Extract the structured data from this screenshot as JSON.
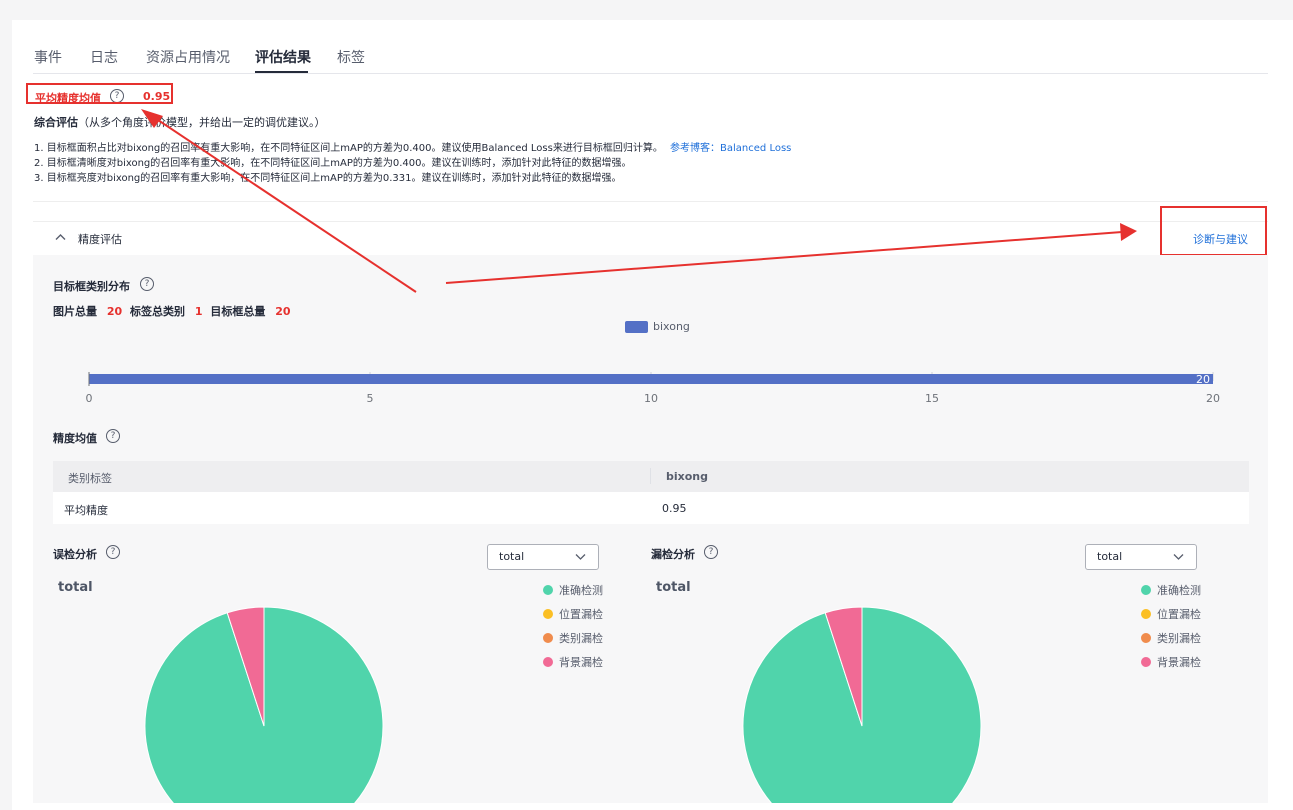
{
  "tabs": [
    {
      "label": "事件",
      "active": false
    },
    {
      "label": "日志",
      "active": false
    },
    {
      "label": "资源占用情况",
      "active": false
    },
    {
      "label": "评估结果",
      "active": true
    },
    {
      "label": "标签",
      "active": false
    }
  ],
  "map": {
    "label": "平均精度均值",
    "value": "0.95"
  },
  "summary": {
    "title": "综合评估",
    "subtitle": "（从多个角度评价模型，并给出一定的调优建议。）",
    "items": [
      "1. 目标框面积占比对bixong的召回率有重大影响，在不同特征区间上mAP的方差为0.400。建议使用Balanced Loss来进行目标框回归计算。",
      "2. 目标框清晰度对bixong的召回率有重大影响，在不同特征区间上mAP的方差为0.400。建议在训练时，添加针对此特征的数据增强。",
      "3. 目标框亮度对bixong的召回率有重大影响，在不同特征区间上mAP的方差为0.331。建议在训练时，添加针对此特征的数据增强。"
    ],
    "link_text": "参考博客：Balanced Loss"
  },
  "section": {
    "title": "精度评估",
    "diagnose_link": "诊断与建议"
  },
  "distribution": {
    "title": "目标框类别分布",
    "image_total_label": "图片总量",
    "image_total_value": "20",
    "label_classes_label": "标签总类别",
    "label_classes_value": "1",
    "box_total_label": "目标框总量",
    "box_total_value": "20"
  },
  "chart_data": [
    {
      "type": "bar",
      "orientation": "horizontal",
      "categories": [
        "bixong"
      ],
      "series": [
        {
          "name": "bixong",
          "values": [
            20
          ],
          "color": "#5470c6"
        }
      ],
      "xlim": [
        0,
        20
      ],
      "xticks": [
        "0",
        "5",
        "10",
        "15",
        "20"
      ],
      "data_labels": [
        "20"
      ],
      "legend": "top-center"
    },
    {
      "type": "pie",
      "title": "total",
      "labels": [
        "准确检测",
        "位置漏检",
        "类别漏检",
        "背景漏检"
      ],
      "values": [
        0.95,
        0,
        0,
        0.05
      ],
      "colors": [
        "#50d4ab",
        "#fbbf24",
        "#f08c4d",
        "#f16a95"
      ]
    },
    {
      "type": "pie",
      "title": "total",
      "labels": [
        "准确检测",
        "位置漏检",
        "类别漏检",
        "背景漏检"
      ],
      "values": [
        0.95,
        0,
        0,
        0.05
      ],
      "colors": [
        "#50d4ab",
        "#fbbf24",
        "#f08c4d",
        "#f16a95"
      ]
    }
  ],
  "map_table": {
    "title": "精度均值",
    "headers": [
      "类别标签",
      "bixong"
    ],
    "row": [
      "平均精度",
      "0.95"
    ]
  },
  "false_detection": {
    "title": "误检分析",
    "select_value": "total"
  },
  "missed_detection": {
    "title": "漏检分析",
    "select_value": "total"
  },
  "icons": [
    "help-icon",
    "chevron-up-icon",
    "chevron-down-icon"
  ]
}
